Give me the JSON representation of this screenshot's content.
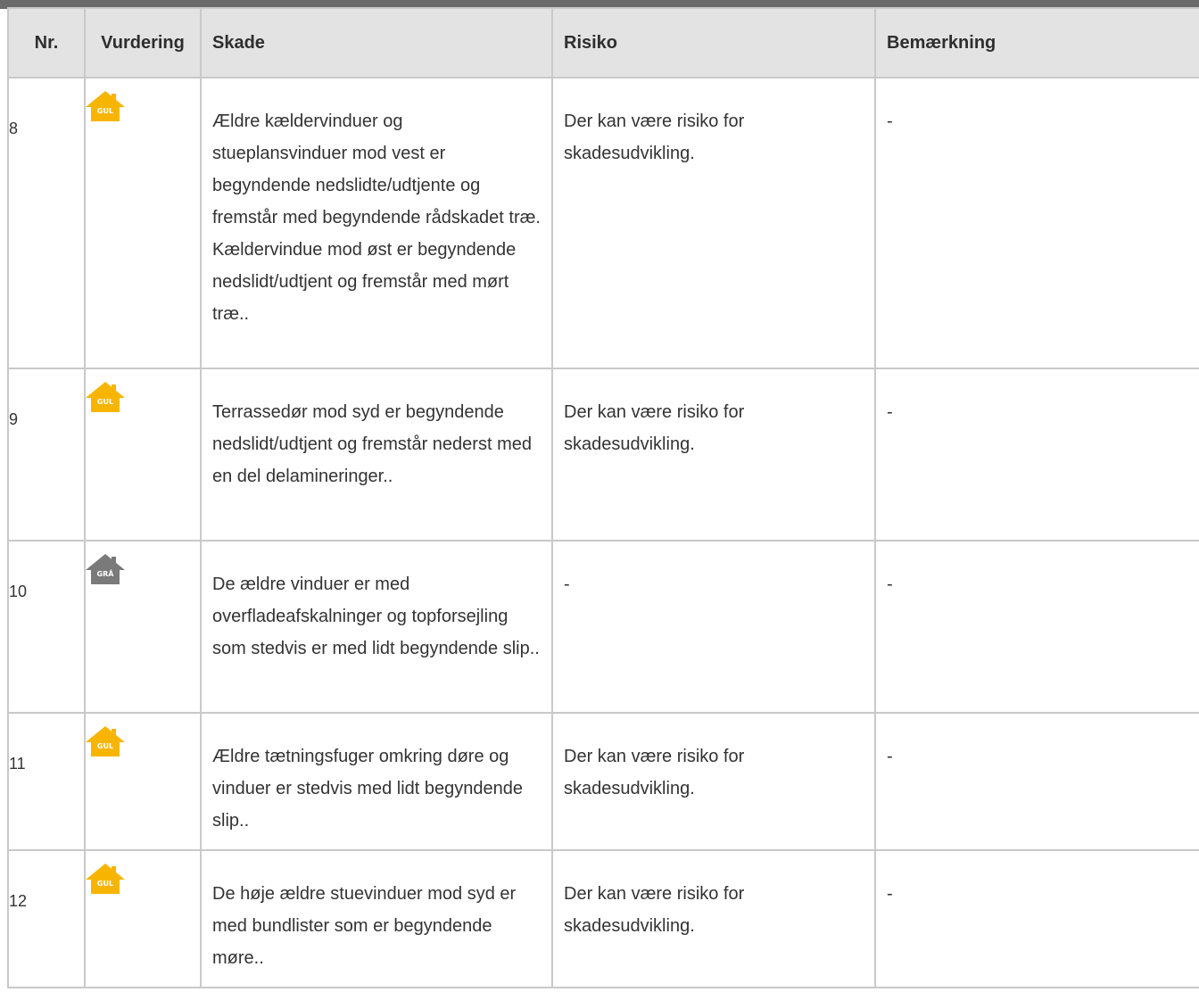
{
  "colors": {
    "gul": "#f7b500",
    "gra": "#7a7a7a",
    "header_bg": "#e3e3e3",
    "border": "#c9c9c9",
    "topbar": "#6b6b6b"
  },
  "table": {
    "headers": {
      "nr": "Nr.",
      "vurdering": "Vurdering",
      "skade": "Skade",
      "risiko": "Risiko",
      "bemaerkning": "Bemærkning"
    },
    "rows": [
      {
        "nr": "8",
        "rating": {
          "label": "GUL",
          "color": "gul",
          "icon": "house-icon"
        },
        "skade": "Ældre kældervinduer og stueplansvinduer mod vest er begyndende nedslidte/udtjente og fremstår med begyndende rådskadet træ. Kældervindue mod øst er begyndende nedslidt/udtjent og fremstår med mørt træ..",
        "risiko": "Der kan være risiko for skadesudvikling.",
        "bemaerkning": "-"
      },
      {
        "nr": "9",
        "rating": {
          "label": "GUL",
          "color": "gul",
          "icon": "house-icon"
        },
        "skade": "Terrassedør mod syd er begyndende nedslidt/udtjent og fremstår nederst med en del delamineringer..",
        "risiko": "Der kan være risiko for skadesudvikling.",
        "bemaerkning": "-"
      },
      {
        "nr": "10",
        "rating": {
          "label": "GRÅ",
          "color": "gra",
          "icon": "house-icon"
        },
        "skade": "De ældre vinduer er med overfladeafskalninger og topforsejling som stedvis er med lidt begyndende slip..",
        "risiko": "-",
        "bemaerkning": "-"
      },
      {
        "nr": "11",
        "rating": {
          "label": "GUL",
          "color": "gul",
          "icon": "house-icon"
        },
        "skade": "Ældre tætningsfuger omkring døre og vinduer er stedvis med lidt begyndende slip..",
        "risiko": "Der kan være risiko for skadesudvikling.",
        "bemaerkning": "-"
      },
      {
        "nr": "12",
        "rating": {
          "label": "GUL",
          "color": "gul",
          "icon": "house-icon"
        },
        "skade": "De høje ældre stuevinduer mod syd er med bundlister som er begyndende møre..",
        "risiko": "Der kan være risiko for skadesudvikling.",
        "bemaerkning": "-"
      }
    ]
  }
}
